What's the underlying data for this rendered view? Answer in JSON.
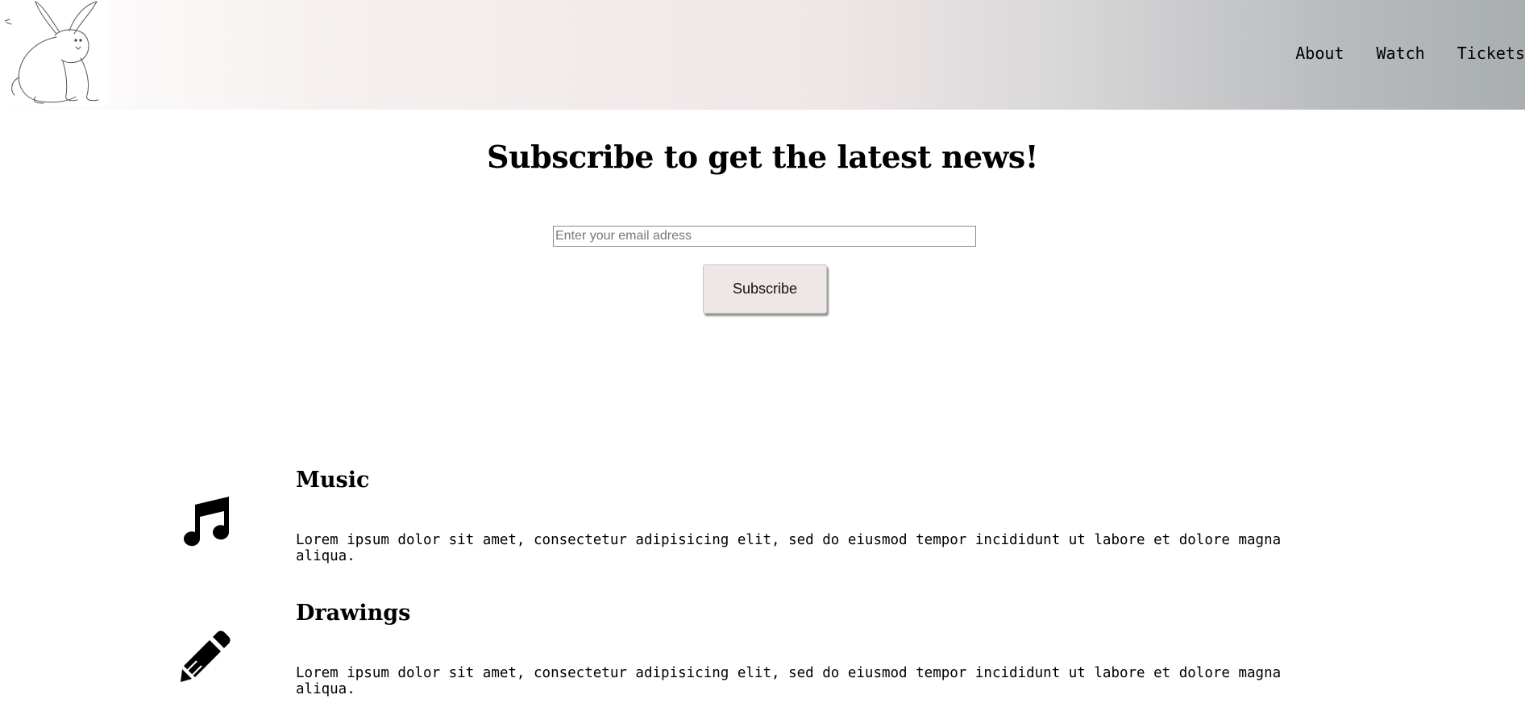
{
  "header": {
    "logo_icon": "rabbit-sketch-icon",
    "nav": [
      {
        "label": "About"
      },
      {
        "label": "Watch"
      },
      {
        "label": "Tickets"
      }
    ]
  },
  "subscribe": {
    "title": "Subscribe to get the latest news!",
    "email_placeholder": "Enter your email adress",
    "email_value": "",
    "button_label": "Subscribe"
  },
  "features": [
    {
      "icon": "music-note-icon",
      "title": "Music",
      "text": "Lorem ipsum dolor sit amet, consectetur adipisicing elit, sed do eiusmod tempor incididunt ut labore et dolore magna aliqua."
    },
    {
      "icon": "pencil-icon",
      "title": "Drawings",
      "text": "Lorem ipsum dolor sit amet, consectetur adipisicing elit, sed do eiusmod tempor incididunt ut labore et dolore magna aliqua."
    }
  ],
  "colors": {
    "header_gradient_start": "#ffffff",
    "header_gradient_mid": "#efe6e6",
    "header_gradient_end": "#a9aeb1",
    "button_bg": "#efe6e6"
  }
}
